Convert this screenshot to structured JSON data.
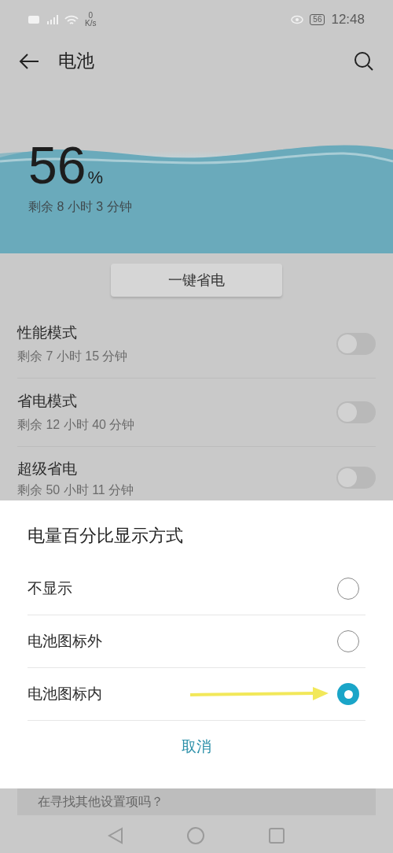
{
  "status_bar": {
    "speed": "0",
    "speed_unit": "K/s",
    "battery": "56",
    "time": "12:48"
  },
  "header": {
    "title": "电池"
  },
  "battery": {
    "percent": "56",
    "unit": "%",
    "remaining": "剩余 8 小时 3 分钟"
  },
  "save_button": "一键省电",
  "modes": [
    {
      "title": "性能模式",
      "subtitle": "剩余 7 小时 15 分钟",
      "on": false
    },
    {
      "title": "省电模式",
      "subtitle": "剩余 12 小时 40 分钟",
      "on": false
    },
    {
      "title": "超级省电",
      "subtitle": "剩余 50 小时 11 分钟",
      "on": false
    }
  ],
  "dialog": {
    "title": "电量百分比显示方式",
    "options": [
      {
        "label": "不显示",
        "selected": false
      },
      {
        "label": "电池图标外",
        "selected": false
      },
      {
        "label": "电池图标内",
        "selected": true
      }
    ],
    "cancel": "取消"
  },
  "hint": "在寻找其他设置项吗？"
}
